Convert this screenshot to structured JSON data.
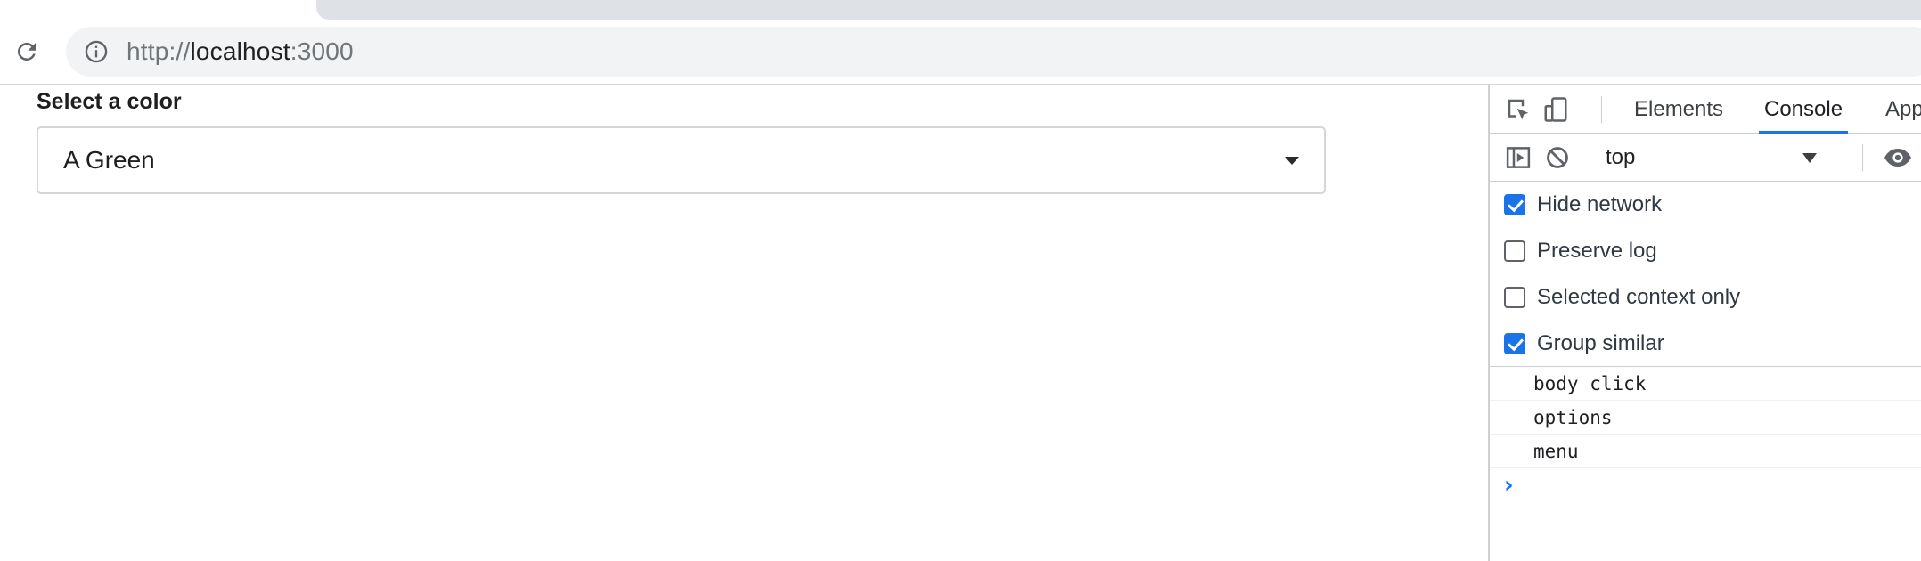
{
  "browser": {
    "url_scheme": "http://",
    "url_host": "localhost",
    "url_port": ":3000"
  },
  "page": {
    "field_label": "Select a color",
    "select_value": "A Green"
  },
  "devtools": {
    "tabs": [
      "Elements",
      "Console",
      "App"
    ],
    "active_tab": "Console",
    "context": "top",
    "settings": [
      {
        "label": "Hide network",
        "checked": true
      },
      {
        "label": "Preserve log",
        "checked": false
      },
      {
        "label": "Selected context only",
        "checked": false
      },
      {
        "label": "Group similar",
        "checked": true
      }
    ],
    "messages": [
      "body click",
      "options",
      "menu"
    ],
    "prompt_symbol": "›"
  },
  "colors": {
    "accent": "#1a73e8",
    "tab_strip": "#dee1e6",
    "omnibox_bg": "#f1f3f4"
  }
}
